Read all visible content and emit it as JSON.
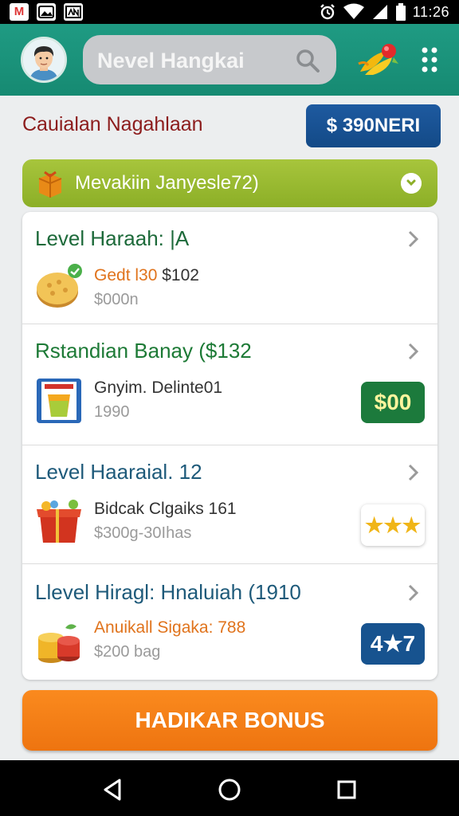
{
  "status_bar": {
    "time": "11:26",
    "notification_icons": [
      "gmail-icon",
      "photos-icon",
      "news-icon"
    ],
    "system_icons": [
      "alarm-icon",
      "wifi-icon",
      "signal-icon",
      "battery-icon"
    ]
  },
  "app_bar": {
    "search_text": "Nevel Hangkai",
    "avatar": "avatar-boy",
    "right_icons": [
      "rocket-icon",
      "more-icon"
    ]
  },
  "header": {
    "title": "Cauialan Nagahlaan",
    "balance_label": "$ 390NERI"
  },
  "banner": {
    "text": "Mevakiin Janyesle72)",
    "icon": "gift-icon"
  },
  "cards": [
    {
      "title": "Level Haraah: |A",
      "line1_a": "Gedt l30",
      "line1_b": " $102",
      "line2": "$000n",
      "thumb": "coin-plate-icon",
      "badge": null
    },
    {
      "title": "Rstandian Banay ($132",
      "line1": "Gnyim. Delinte01",
      "line2": "1990",
      "thumb": "juice-box-icon",
      "badge": "$00"
    },
    {
      "title": "Level Haaraial. 12",
      "line1": "Bidcak Clgaiks 161",
      "line2": "$300g-30Ihas",
      "thumb": "gift-box-icon",
      "badge": "★★★"
    },
    {
      "title": "Llevel Hiragl: Hnaluiah (1910",
      "line1": "Anuikall Sigaka: 788",
      "line2": "$200 bag",
      "thumb": "coin-stack-icon",
      "badge": "4★7"
    }
  ],
  "bonus_button": "HADIKAR BONUS",
  "nav": [
    "back-icon",
    "home-icon",
    "recents-icon"
  ],
  "colors": {
    "app_bar": "#1f9b83",
    "title": "#8c1c1c",
    "balance": "#1e5aa0",
    "banner": "#9cbc33",
    "bonus": "#f5821a",
    "green_badge": "#1c7a3c",
    "blue_badge": "#17538f"
  }
}
